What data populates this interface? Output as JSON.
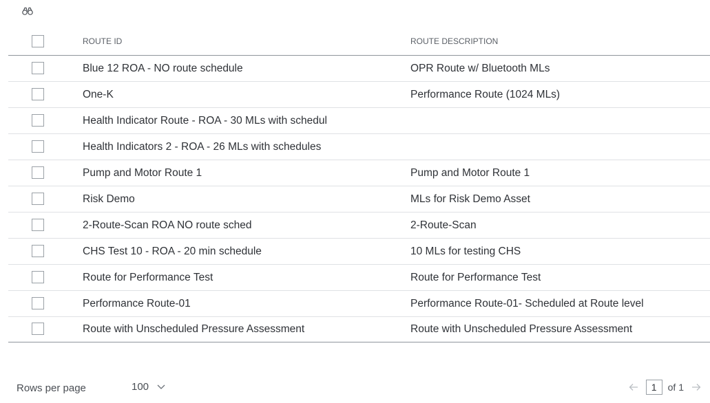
{
  "header": {
    "col_id": "ROUTE ID",
    "col_desc": "ROUTE DESCRIPTION"
  },
  "rows": [
    {
      "id": "Blue 12 ROA - NO route schedule",
      "desc": "OPR Route w/ Bluetooth MLs"
    },
    {
      "id": "One-K",
      "desc": "Performance Route (1024 MLs)"
    },
    {
      "id": "Health Indicator Route - ROA - 30 MLs with schedul",
      "desc": ""
    },
    {
      "id": "Health Indicators 2 - ROA - 26 MLs with schedules",
      "desc": ""
    },
    {
      "id": "Pump and Motor Route 1",
      "desc": "Pump and Motor Route 1"
    },
    {
      "id": "Risk Demo",
      "desc": "MLs for Risk Demo Asset"
    },
    {
      "id": "2-Route-Scan ROA NO route sched",
      "desc": "2-Route-Scan"
    },
    {
      "id": "CHS Test 10 - ROA - 20 min schedule",
      "desc": "10 MLs for testing CHS"
    },
    {
      "id": "Route for Performance Test",
      "desc": "Route for Performance Test"
    },
    {
      "id": "Performance Route-01",
      "desc": "Performance Route-01- Scheduled at Route level"
    },
    {
      "id": "Route with Unscheduled Pressure Assessment",
      "desc": "Route with Unscheduled Pressure Assessment"
    }
  ],
  "footer": {
    "rows_per_page_label": "Rows per page",
    "rows_per_page_value": "100",
    "current_page": "1",
    "of_label": "of 1"
  },
  "icons": {
    "find": "binoculars-icon",
    "dropdown": "chevron-down-icon",
    "prev": "arrow-left-icon",
    "next": "arrow-right-icon"
  },
  "colors": {
    "border_strong": "#8e949b",
    "border_light": "#dfe1e4",
    "arrow_disabled": "#b9bdc2"
  }
}
